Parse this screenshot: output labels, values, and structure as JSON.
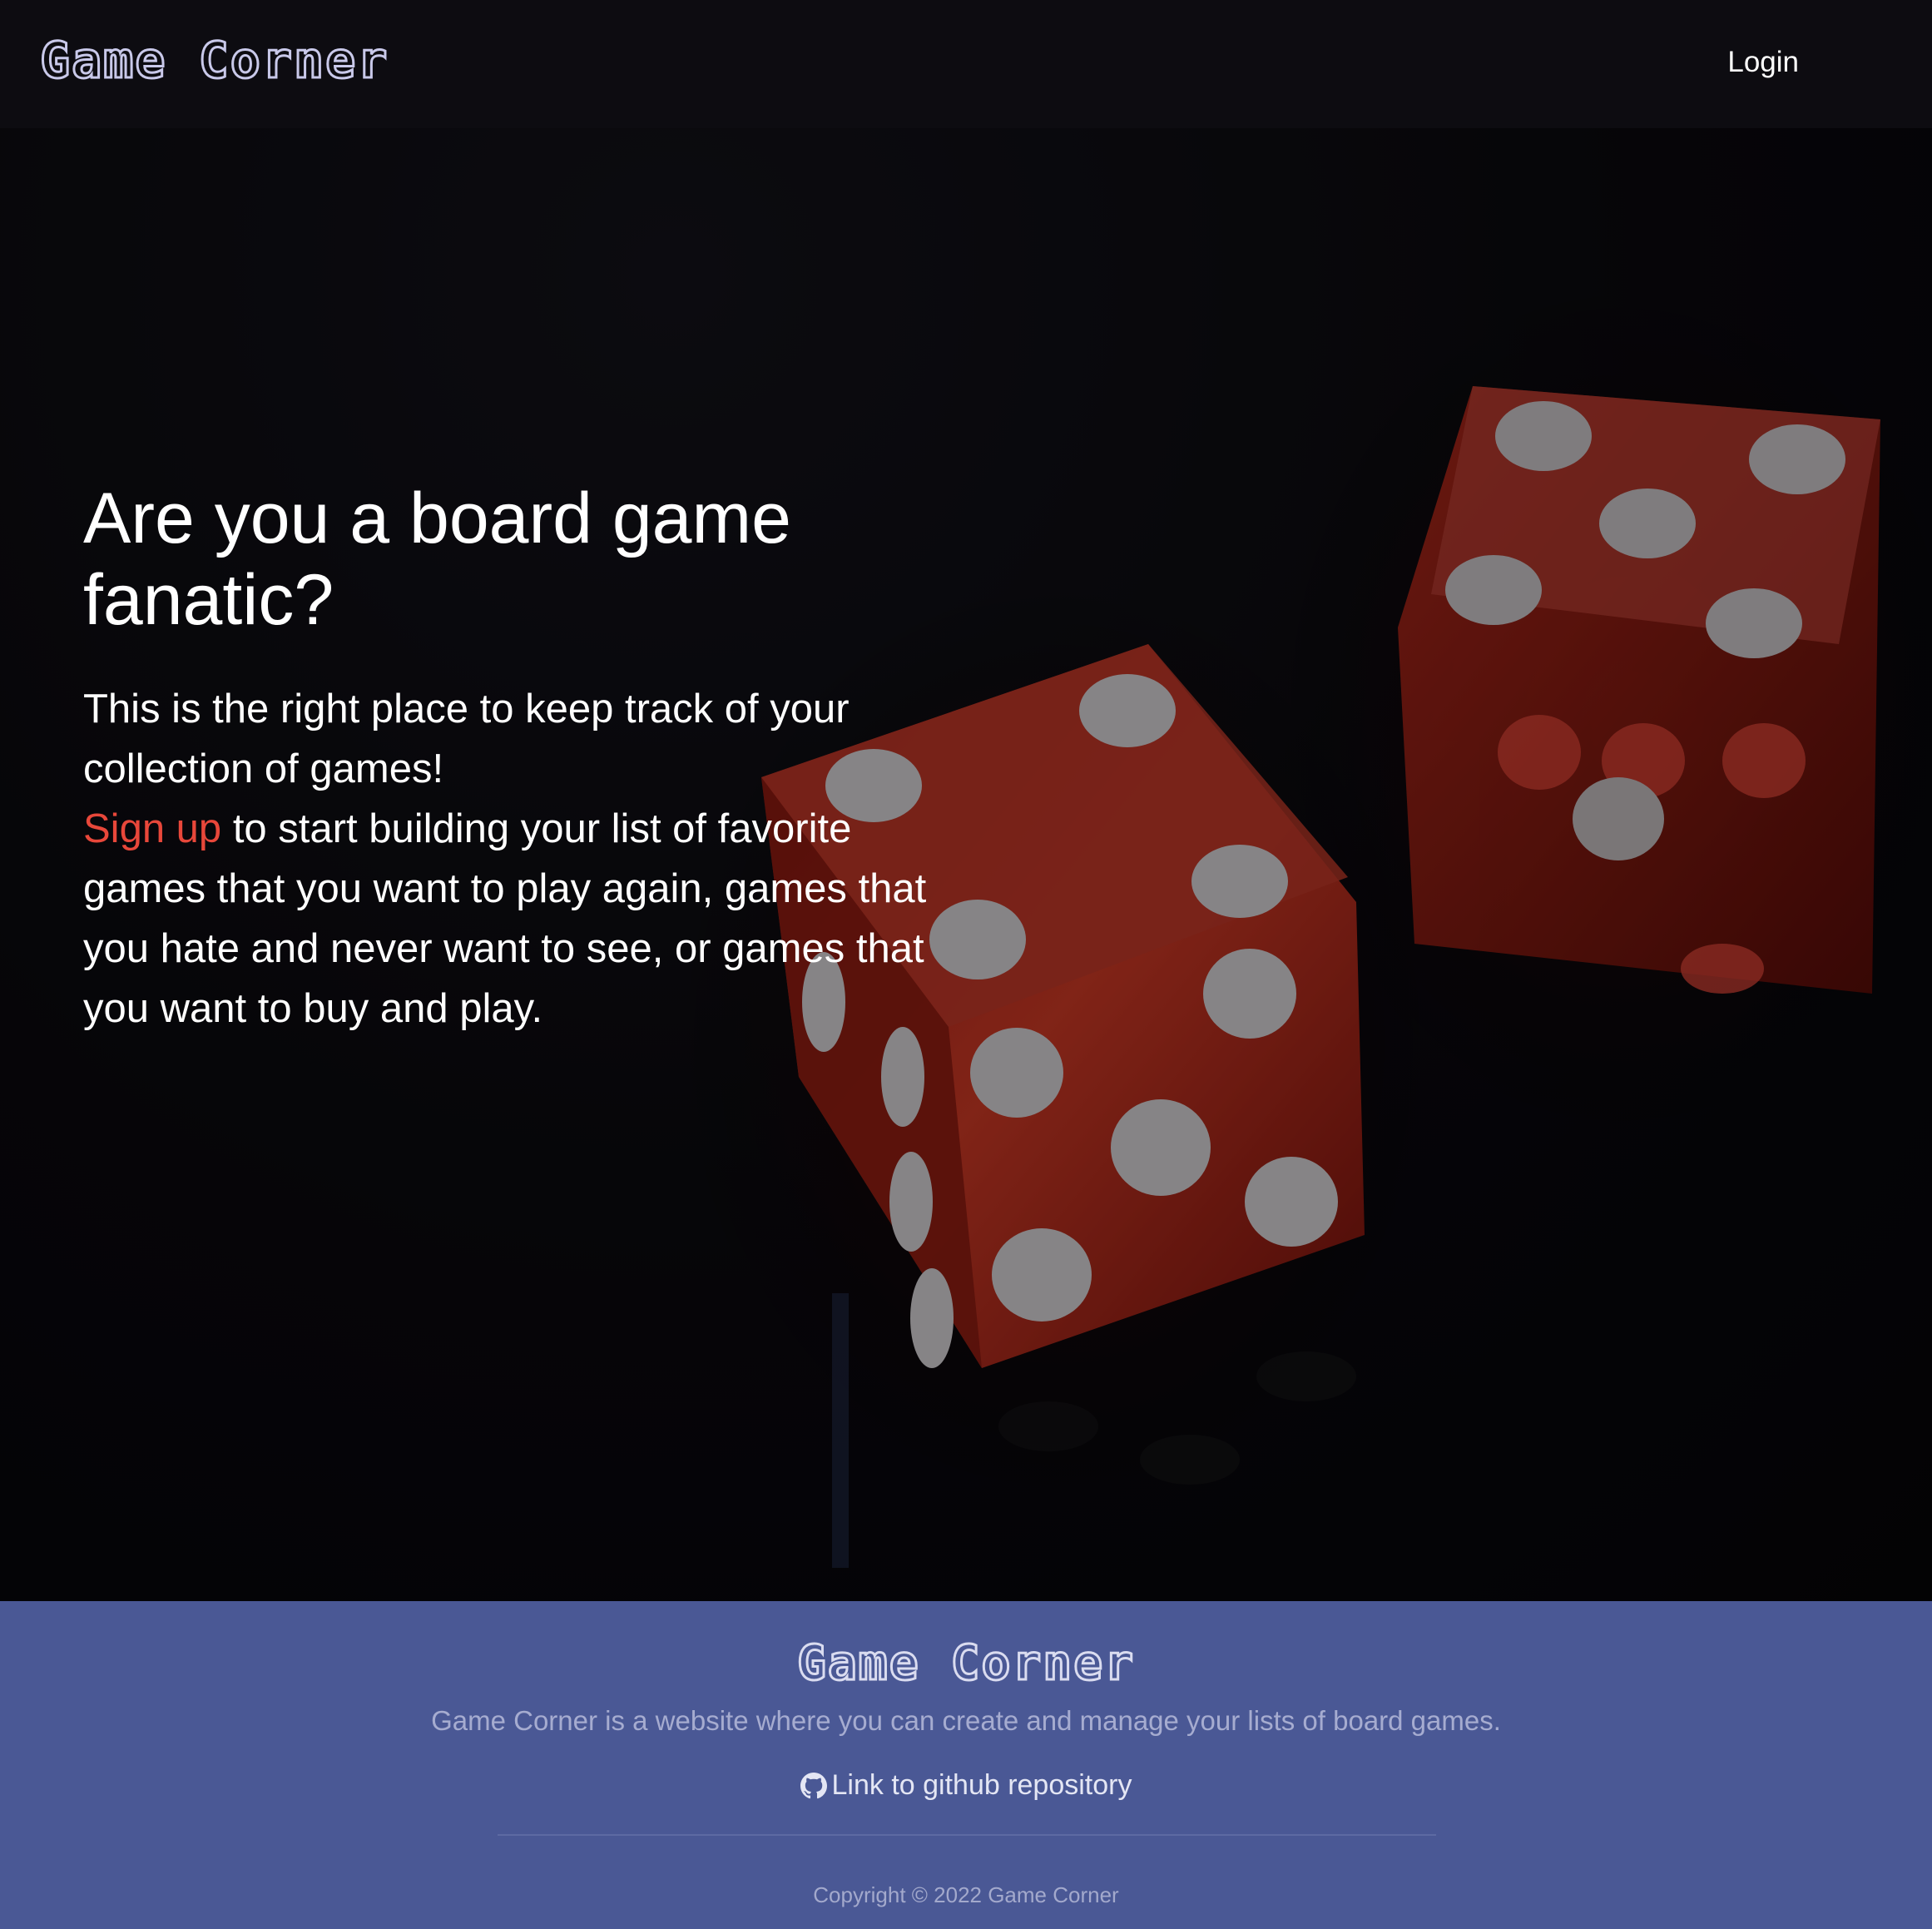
{
  "header": {
    "logo": "Game Corner",
    "login_label": "Login"
  },
  "hero": {
    "title": "Are you a board game fanatic?",
    "intro": "This is the right place to keep track of your collection of games!",
    "signup_label": "Sign up",
    "body": " to start building your list of favorite games that you want to play again, games that you hate and never want to see, or games that you want to buy and play."
  },
  "footer": {
    "logo": "Game Corner",
    "description": "Game Corner is a website where you can create and manage your lists of board games.",
    "github_label": "Link to github repository",
    "copyright": "Copyright © 2022 Game Corner"
  },
  "colors": {
    "accent": "#e8473a",
    "footer_bg": "#4a5895",
    "page_bg": "#0b0a0f"
  },
  "icons": {
    "github": "github-icon",
    "dice": "dice-image"
  }
}
